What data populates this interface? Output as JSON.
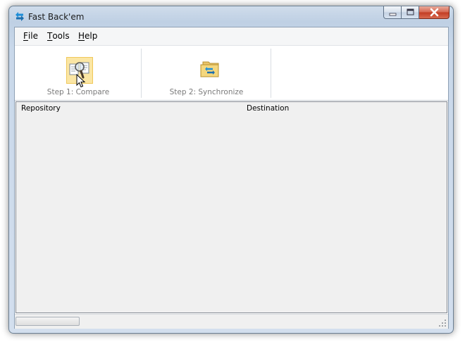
{
  "window": {
    "title": "Fast Back'em"
  },
  "menu": {
    "items": [
      {
        "first": "F",
        "rest": "ile"
      },
      {
        "first": "T",
        "rest": "ools"
      },
      {
        "first": "H",
        "rest": "elp"
      }
    ]
  },
  "toolbar": {
    "compare_label": "Step 1: Compare",
    "sync_label": "Step 2: Synchronize"
  },
  "list": {
    "columns": [
      "Repository",
      "Destination"
    ]
  },
  "status": {
    "progress": 0
  },
  "icons": {
    "app": "sync-arrows-icon",
    "compare": "magnifier-documents-icon",
    "sync": "folder-sync-icon",
    "cursor": "mouse-pointer-icon",
    "grip": "resize-grip-icon"
  }
}
